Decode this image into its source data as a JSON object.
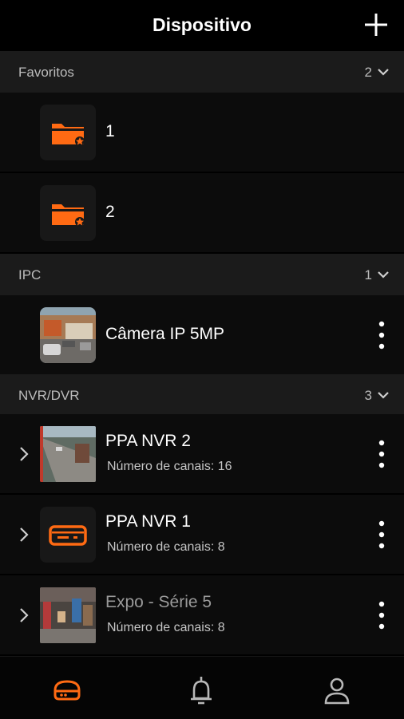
{
  "header": {
    "title": "Dispositivo",
    "add_icon": "plus-icon"
  },
  "sections": {
    "favorites": {
      "name": "Favoritos",
      "count": "2"
    },
    "ipc": {
      "name": "IPC",
      "count": "1"
    },
    "nvr": {
      "name": "NVR/DVR",
      "count": "3"
    }
  },
  "favorites": [
    {
      "label": "1",
      "icon": "favorite-folder-icon"
    },
    {
      "label": "2",
      "icon": "favorite-folder-icon"
    }
  ],
  "ipc": [
    {
      "label": "Câmera IP 5MP"
    }
  ],
  "nvr": [
    {
      "label": "PPA NVR 2",
      "channels": "Número de canais: 16",
      "online": true
    },
    {
      "label": "PPA NVR 1",
      "channels": "Número de canais: 8",
      "online": true,
      "icon": "recorder-icon"
    },
    {
      "label": "Expo - Série 5",
      "channels": "Número de canais: 8",
      "online": false
    }
  ],
  "tabs": [
    {
      "name": "devices-tab",
      "icon": "device-icon",
      "active": true
    },
    {
      "name": "alarms-tab",
      "icon": "bell-icon",
      "active": false
    },
    {
      "name": "profile-tab",
      "icon": "user-icon",
      "active": false
    }
  ],
  "colors": {
    "accent": "#ff6a13",
    "background": "#000000",
    "section": "#1b1b1b",
    "row": "#0c0c0c",
    "muted": "#bcbcbc"
  }
}
